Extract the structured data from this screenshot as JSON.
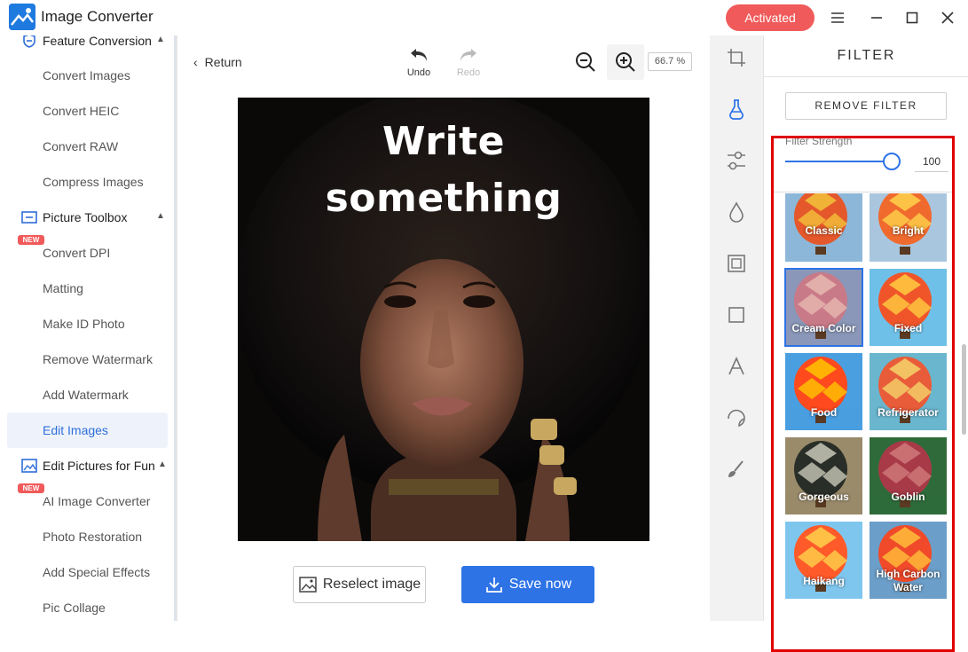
{
  "app": {
    "title": "Image Converter",
    "activated_label": "Activated"
  },
  "sidebar": {
    "groups": [
      {
        "label": "Feature Conversion",
        "icon": "shield-icon"
      },
      {
        "label": "Picture Toolbox",
        "icon": "toolbox-icon"
      },
      {
        "label": "Edit Pictures for Fun",
        "icon": "image-edit-icon"
      }
    ],
    "items": [
      "Convert Images",
      "Convert HEIC",
      "Convert RAW",
      "Compress Images",
      "Convert DPI",
      "Matting",
      "Make ID Photo",
      "Remove Watermark",
      "Add Watermark",
      "Edit Images",
      "AI Image Converter",
      "Photo Restoration",
      "Add Special Effects",
      "Pic Collage"
    ],
    "active_item": "Edit Images",
    "new_badge": "NEW"
  },
  "editor": {
    "return_label": "Return",
    "undo_label": "Undo",
    "redo_label": "Redo",
    "zoom_level": "66.7 %",
    "image_text_line1": "Write",
    "image_text_line2": "something",
    "reselect_label": "Reselect image",
    "save_label": "Save now"
  },
  "filter": {
    "title": "FILTER",
    "remove_label": "REMOVE FILTER",
    "strength_label": "Filter Strength",
    "strength_value": "100",
    "strength_fraction": 1.0,
    "selected": "Cream Color",
    "presets": [
      "Classic",
      "Bright",
      "Cream Color",
      "Fixed",
      "Food",
      "Refrigerator",
      "Gorgeous",
      "Goblin",
      "Haikang",
      "High Carbon Water"
    ]
  },
  "colors": {
    "accent": "#2d73e6",
    "activated": "#f05a5a",
    "highlight_box": "#e00000"
  }
}
